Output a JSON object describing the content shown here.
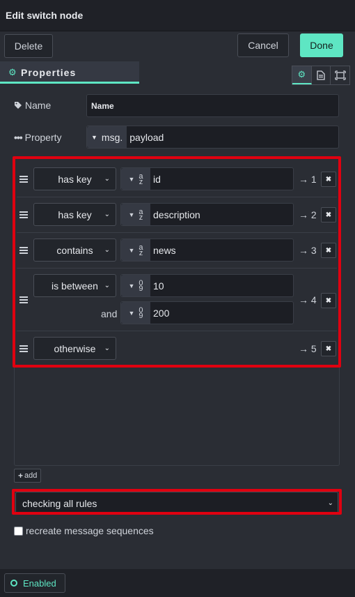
{
  "dialog": {
    "title": "Edit switch node"
  },
  "toolbar": {
    "delete_label": "Delete",
    "cancel_label": "Cancel",
    "done_label": "Done"
  },
  "tabs": {
    "properties_label": "Properties"
  },
  "properties": {
    "name_label": "Name",
    "name_value": "Name",
    "property_label": "Property",
    "property_prefix": "msg.",
    "property_value": "payload"
  },
  "rules": [
    {
      "operator": "has key",
      "type": "string",
      "value": "id",
      "output": "→ 1"
    },
    {
      "operator": "has key",
      "type": "string",
      "value": "description",
      "output": "→ 2"
    },
    {
      "operator": "contains",
      "type": "string",
      "value": "news",
      "output": "→ 3"
    },
    {
      "operator": "is between",
      "type": "number",
      "value": "10",
      "and_label": "and",
      "value2": "200",
      "output": "→ 4"
    },
    {
      "operator": "otherwise",
      "output": "→ 5"
    }
  ],
  "add_button_label": "add",
  "mode_select": {
    "value": "checking all rules"
  },
  "recreate_label": "recreate message sequences",
  "status": {
    "enabled_label": "Enabled"
  },
  "colors": {
    "accent": "#5ee6c3",
    "highlight": "#e00010"
  }
}
